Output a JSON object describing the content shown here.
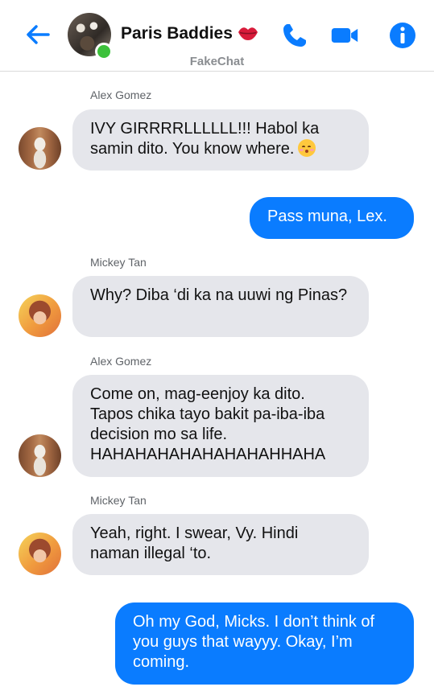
{
  "header": {
    "title": "Paris Baddies",
    "subtitle": "FakeChat",
    "colors": {
      "accent": "#0a7cff",
      "online": "#3cc13b"
    },
    "icons": [
      "back-arrow-icon",
      "lips-icon",
      "phone-icon",
      "video-camera-icon",
      "info-icon"
    ]
  },
  "messages": [
    {
      "sender": "Alex Gomez",
      "direction": "incoming",
      "text": "IVY GIRRRRLLLLLL!!! Habol ka samin dito. You know where.",
      "emoji": "kissing-face-smiling-eyes"
    },
    {
      "direction": "outgoing",
      "text": "Pass muna, Lex."
    },
    {
      "sender": "Mickey Tan",
      "direction": "incoming",
      "text": "Why? Diba ‘di ka na uuwi ng Pinas?"
    },
    {
      "sender": "Alex Gomez",
      "direction": "incoming",
      "text": "Come on, mag-eenjoy ka dito. Tapos chika tayo bakit pa-iba-iba decision mo sa life. HAHAHAHAHAHAHAHAHHAHA"
    },
    {
      "sender": "Mickey Tan",
      "direction": "incoming",
      "text": "Yeah, right. I swear, Vy. Hindi naman illegal ‘to."
    },
    {
      "direction": "outgoing",
      "text": "Oh my God, Micks. I don’t think of you guys that wayyy. Okay, I’m coming."
    }
  ]
}
